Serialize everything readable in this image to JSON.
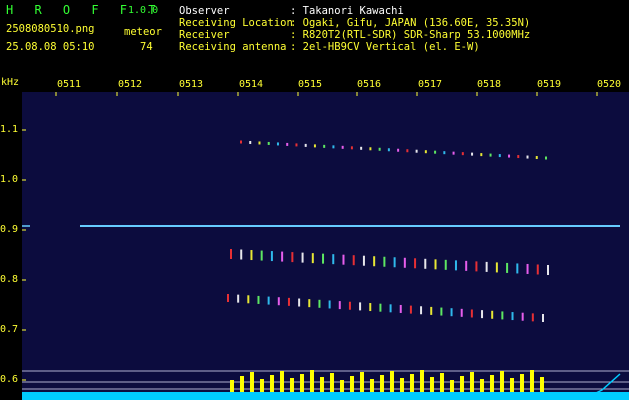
{
  "app": {
    "title": "H R O F F T",
    "version": "1.0.0"
  },
  "file": {
    "name": "2508080510.png",
    "datetime": "25.08.08 05:10"
  },
  "meteor": {
    "label": "meteor",
    "count": "74"
  },
  "info": [
    {
      "key": "Observer",
      "value": ": Takanori Kawachi"
    },
    {
      "key": "Receiving Location",
      "value": ": Ogaki, Gifu, JAPAN (136.60E, 35.35N)"
    },
    {
      "key": "Receiver",
      "value": ": R820T2(RTL-SDR) SDR-Sharp 53.1000MHz"
    },
    {
      "key": "Receiving antenna",
      "value": ": 2el-HB9CV Vertical (el. E-W)"
    }
  ],
  "axis": {
    "unit": "kHz",
    "y_ticks": [
      "1.1",
      "1.0",
      "0.9",
      "0.8",
      "0.7",
      "0.6"
    ],
    "x_ticks": [
      "0511",
      "0512",
      "0513",
      "0514",
      "0515",
      "0516",
      "0517",
      "0518",
      "0519",
      "0520"
    ]
  },
  "colors": {
    "background": "#000000",
    "spectrum_bg": "#0c0c3e",
    "header_green": "#33ff33",
    "header_yellow": "#ffff33",
    "carrier": "#66ccff",
    "level_bars": "#ffff00",
    "baseline": "#00ccff"
  }
}
